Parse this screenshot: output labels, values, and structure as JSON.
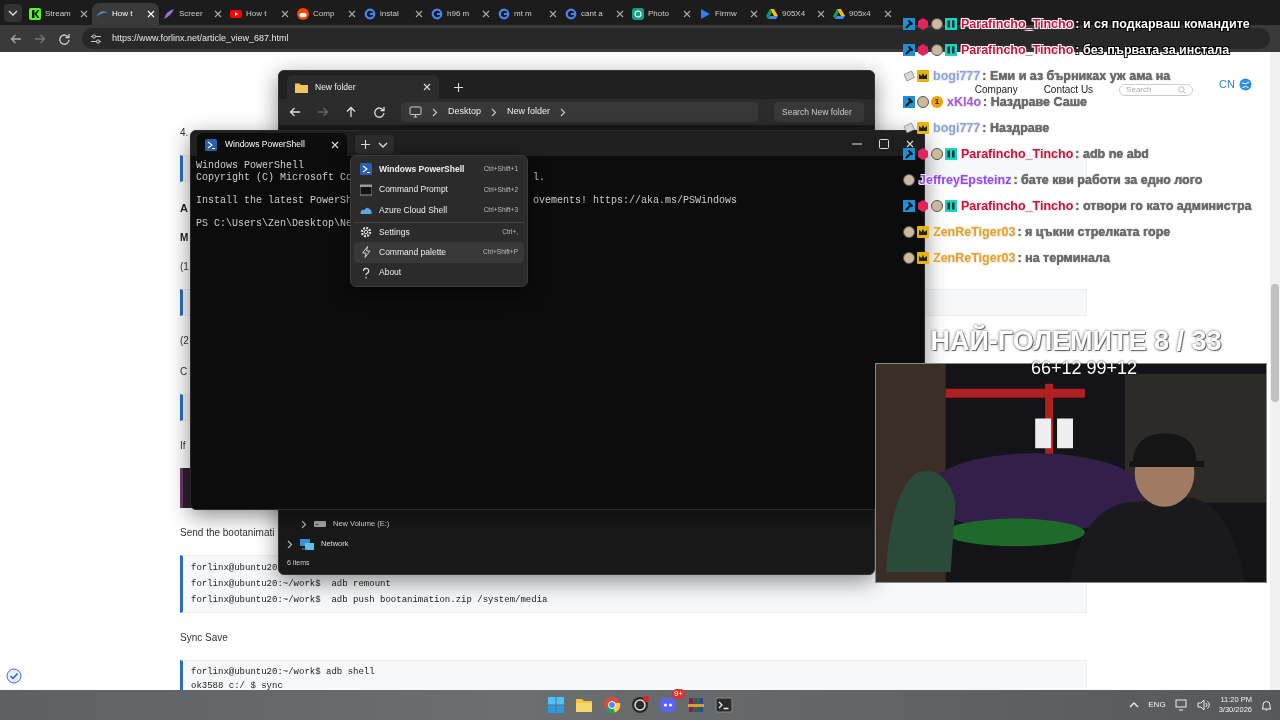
{
  "browser": {
    "tabs": [
      {
        "title": "Stream",
        "kind": "kick",
        "selected": false
      },
      {
        "title": "How t",
        "kind": "wing",
        "selected": true
      },
      {
        "title": "Screer",
        "kind": "feather",
        "selected": false
      },
      {
        "title": "How t",
        "kind": "video",
        "selected": false
      },
      {
        "title": "Comp",
        "kind": "alien",
        "selected": false
      },
      {
        "title": "instal",
        "kind": "ring",
        "selected": false
      },
      {
        "title": "h96 m",
        "kind": "ring",
        "selected": false
      },
      {
        "title": "mt m",
        "kind": "ring",
        "selected": false
      },
      {
        "title": "cant a",
        "kind": "ring",
        "selected": false
      },
      {
        "title": "Photo",
        "kind": "knot",
        "selected": false
      },
      {
        "title": "Firmw",
        "kind": "play",
        "selected": false
      },
      {
        "title": "905X4",
        "kind": "triangle",
        "selected": false
      },
      {
        "title": "905x4",
        "kind": "triangle",
        "selected": false
      }
    ],
    "url": "https://www.forlinx.net/article_view_687.html"
  },
  "page": {
    "nav": [
      "Company",
      "Contact Us"
    ],
    "search": {
      "placeholder": "Search"
    },
    "language": "CN",
    "content": [
      {
        "kind": "text",
        "text": "4."
      },
      {
        "kind": "code"
      },
      {
        "kind": "heading",
        "text": "A"
      },
      {
        "kind": "subheading",
        "text": "M"
      },
      {
        "kind": "text",
        "text": "(1"
      },
      {
        "kind": "code"
      },
      {
        "kind": "text",
        "text": "(2"
      },
      {
        "kind": "text",
        "text": "C"
      },
      {
        "kind": "code"
      },
      {
        "kind": "text",
        "text": "If"
      },
      {
        "kind": "dark-code"
      },
      {
        "kind": "text",
        "text": "Send the bootanimati"
      },
      {
        "kind": "code",
        "lines": [
          "forlinx@ubuntu20",
          "forlinx@ubuntu20:~/work$  adb remount",
          "forlinx@ubuntu20:~/work$  adb push bootanimation.zip /system/media"
        ]
      },
      {
        "kind": "text",
        "text": "Sync Save"
      },
      {
        "kind": "code",
        "lines": [
          "forlinx@ubuntu20:~/work$ adb shell",
          "ok3588 c:/ $ sync"
        ]
      }
    ]
  },
  "explorer": {
    "tab": "New folder",
    "breadcrumb": [
      "Desktop",
      "New folder"
    ],
    "search": {
      "placeholder": "Search New folder"
    },
    "tree": [
      {
        "label": "New Volume (E:)",
        "kind": "drive"
      },
      {
        "label": "Network",
        "kind": "network"
      }
    ],
    "status": "6 items"
  },
  "terminal": {
    "tab": "Windows PowerShell",
    "lines": [
      {
        "kind": "text",
        "text": "Windows PowerShell"
      },
      {
        "kind": "text",
        "text": "Copyright (C) Microsoft Co",
        "after_menu": "l."
      },
      {
        "kind": "blank"
      },
      {
        "kind": "text",
        "text": "Install the latest PowerSh",
        "after_menu": "ovements! https://aka.ms/PSWindows"
      },
      {
        "kind": "blank"
      },
      {
        "kind": "text",
        "text": "PS C:\\Users\\Zen\\Desktop\\Ne"
      }
    ],
    "menu": [
      {
        "label": "Windows PowerShell",
        "shortcut": "Ctrl+Shift+1",
        "kind": "shell",
        "default": true,
        "divider_before": false,
        "hovered": false
      },
      {
        "label": "Command Prompt",
        "shortcut": "Ctrl+Shift+2",
        "kind": "console",
        "default": false,
        "divider_before": false,
        "hovered": false
      },
      {
        "label": "Azure Cloud Shell",
        "shortcut": "Ctrl+Shift+3",
        "kind": "cloud",
        "default": false,
        "divider_before": false,
        "hovered": false
      },
      {
        "label": "Settings",
        "shortcut": "Ctrl+,",
        "kind": "settings",
        "default": false,
        "divider_before": true,
        "hovered": false
      },
      {
        "label": "Command palette",
        "shortcut": "Ctrl+Shift+P",
        "kind": "palette",
        "default": false,
        "divider_before": false,
        "hovered": true
      },
      {
        "label": "About",
        "kind": "about",
        "default": false,
        "divider_before": false,
        "hovered": false
      }
    ]
  },
  "chat": [
    {
      "user": "Parafincho_Tincho",
      "color": "#d0103a",
      "text": ": и ся подкарваш командите",
      "faded": false,
      "badges": [
        {
          "kind": "hammer"
        },
        {
          "kind": "cube"
        },
        {
          "kind": "face"
        },
        {
          "kind": "grid"
        }
      ]
    },
    {
      "user": "Parafincho_Tincho",
      "color": "#d0103a",
      "text": ": без първата за инстала",
      "faded": false,
      "badges": [
        {
          "kind": "hammer"
        },
        {
          "kind": "cube"
        },
        {
          "kind": "face"
        },
        {
          "kind": "grid"
        }
      ]
    },
    {
      "user": "bogi777",
      "color": "#8aa4d8",
      "text": ": Еми и аз бърниках уж ама на",
      "faded": true,
      "badges": [
        {
          "kind": "ticket"
        },
        {
          "kind": "crown"
        }
      ]
    },
    {
      "user": "xKl4o",
      "color": "#a05ad8",
      "text": ": Наздраве Саше",
      "faded": true,
      "badges": [
        {
          "kind": "hammer"
        },
        {
          "kind": "face"
        },
        {
          "kind": "count",
          "text": "1"
        }
      ]
    },
    {
      "user": "bogi777",
      "color": "#8aa4d8",
      "text": ": Наздраве",
      "faded": true,
      "badges": [
        {
          "kind": "ticket"
        },
        {
          "kind": "crown"
        }
      ]
    },
    {
      "user": "Parafincho_Tincho",
      "color": "#d0103a",
      "text": ": adb ne abd",
      "faded": true,
      "badges": [
        {
          "kind": "hammer"
        },
        {
          "kind": "cube"
        },
        {
          "kind": "face"
        },
        {
          "kind": "grid"
        }
      ]
    },
    {
      "user": "JeffreyEpsteinz",
      "color": "#9146ff",
      "text": ": бате кви работи за едно лого",
      "faded": true,
      "badges": [
        {
          "kind": "face"
        }
      ]
    },
    {
      "user": "Parafincho_Tincho",
      "color": "#d0103a",
      "text": ": отвори го като администра",
      "faded": true,
      "badges": [
        {
          "kind": "hammer"
        },
        {
          "kind": "cube"
        },
        {
          "kind": "face"
        },
        {
          "kind": "grid"
        }
      ]
    },
    {
      "user": "ZenReTiger03",
      "color": "#e8a020",
      "text": ": я цъкни стрелката горе",
      "faded": true,
      "badges": [
        {
          "kind": "face"
        },
        {
          "kind": "crown"
        }
      ]
    },
    {
      "user": "ZenReTiger03",
      "color": "#e8a020",
      "text": ": на терминала",
      "faded": true,
      "badges": [
        {
          "kind": "face"
        },
        {
          "kind": "crown"
        }
      ]
    }
  ],
  "stream": {
    "title": "НАЙ-ГОЛЕМИТЕ 8 / 33",
    "subtitle": "66+12 99+12"
  },
  "taskbar": {
    "apps": [
      {
        "kind": "start"
      },
      {
        "kind": "folder"
      },
      {
        "kind": "browser"
      },
      {
        "kind": "recorder"
      },
      {
        "kind": "chat",
        "badge": "9+"
      },
      {
        "kind": "archive"
      },
      {
        "kind": "terminal"
      }
    ],
    "tray": {
      "language": "ENG",
      "time": "11:20 PM",
      "date": "3/30/2026"
    }
  }
}
